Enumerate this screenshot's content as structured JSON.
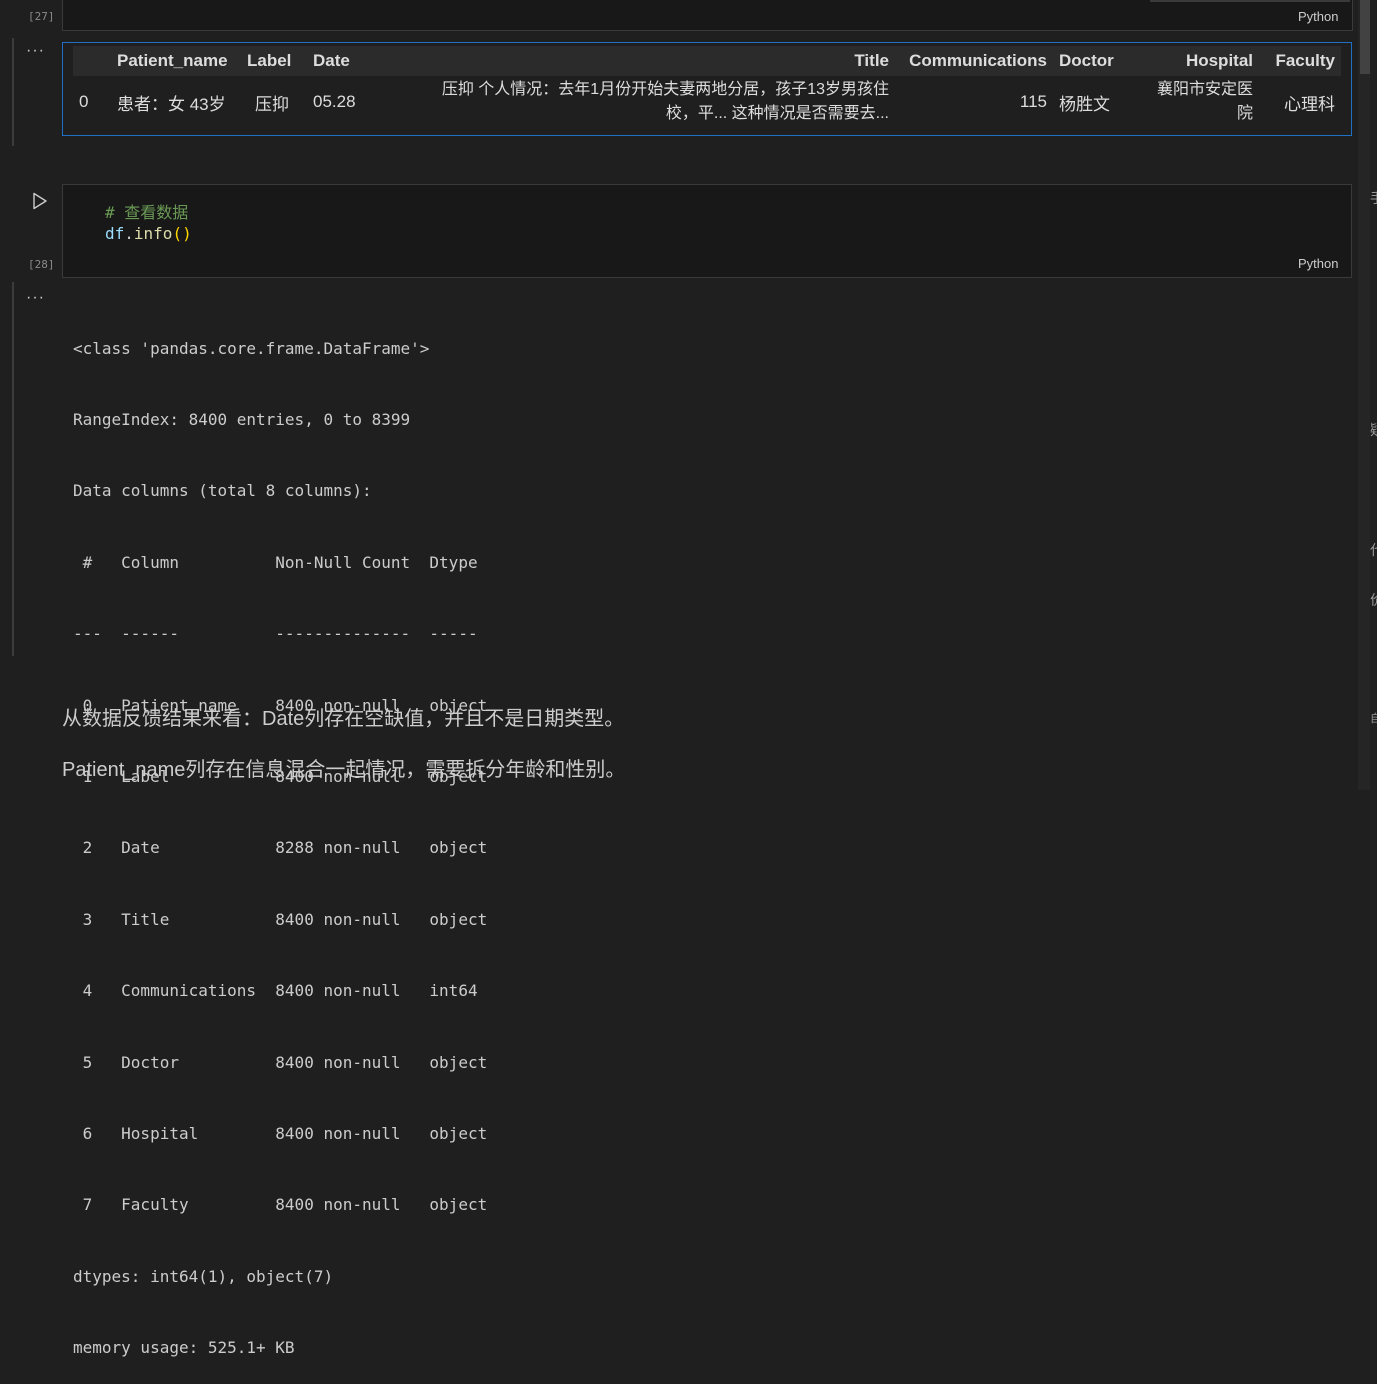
{
  "cell27": {
    "exec_count": "[27]",
    "language": "Python"
  },
  "df_output": {
    "more_label": "···",
    "columns": [
      "",
      "Patient_name",
      "Label",
      "Date",
      "Title",
      "Communications",
      "Doctor",
      "Hospital",
      "Faculty"
    ],
    "row": {
      "index": "0",
      "patient_name": "患者：女 43岁",
      "label": "压抑",
      "date": "05.28",
      "title_line1": "压抑 个人情况：去年1月份开始夫妻两地分居，孩子13岁男孩住",
      "title_line2": "校，平... 这种情况是否需要去...",
      "communications": "115",
      "doctor": "杨胜文",
      "hospital_line1": "襄阳市安定医",
      "hospital_line2": "院",
      "faculty": "心理科"
    }
  },
  "cell28": {
    "exec_count": "[28]",
    "language": "Python",
    "code_comment": "# 查看数据",
    "code_obj": "df",
    "code_dot": ".",
    "code_fn": "info",
    "code_parens": "()"
  },
  "info_output": {
    "more_label": "···",
    "lines": [
      "<class 'pandas.core.frame.DataFrame'>",
      "RangeIndex: 8400 entries, 0 to 8399",
      "Data columns (total 8 columns):",
      " #   Column          Non-Null Count  Dtype ",
      "---  ------          --------------  ----- ",
      " 0   Patient_name    8400 non-null   object",
      " 1   Label           8400 non-null   object",
      " 2   Date            8288 non-null   object",
      " 3   Title           8400 non-null   object",
      " 4   Communications  8400 non-null   int64 ",
      " 5   Doctor          8400 non-null   object",
      " 6   Hospital        8400 non-null   object",
      " 7   Faculty         8400 non-null   object",
      "dtypes: int64(1), object(7)",
      "memory usage: 525.1+ KB"
    ]
  },
  "markdown": {
    "line1": "从数据反馈结果来看：Date列存在空缺值，并且不是日期类型。",
    "line2": "Patient_name列存在信息混合一起情况，需要拆分年龄和性别。"
  },
  "right_edge_glyphs": [
    "手",
    "疑",
    "代",
    "价",
    "自"
  ]
}
